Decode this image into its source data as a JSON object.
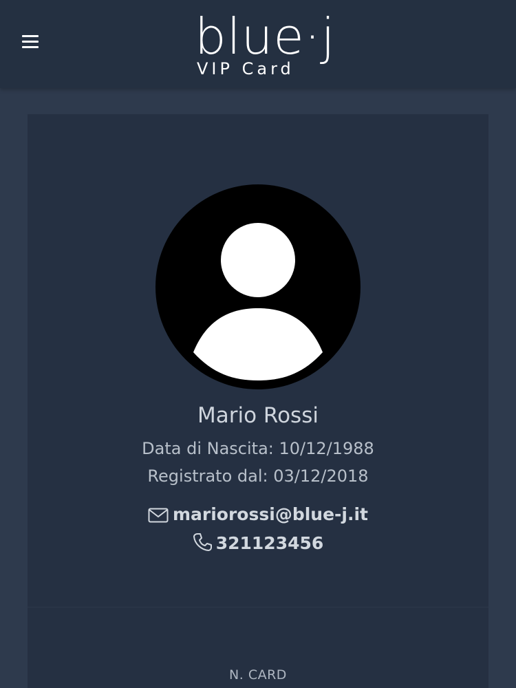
{
  "header": {
    "logo_main": "blue·j",
    "logo_sub": "VIP Card",
    "menu_icon": "hamburger-menu-icon"
  },
  "profile": {
    "avatar_icon": "user-avatar-icon",
    "name": "Mario Rossi",
    "birth_date": "Data di Nascita: 10/12/1988",
    "registered": "Registrato dal: 03/12/2018",
    "email": "mariorossi@blue-j.it",
    "email_icon": "envelope-icon",
    "phone": "321123456",
    "phone_icon": "phone-icon"
  },
  "card": {
    "number_label": "N. CARD"
  },
  "colors": {
    "background": "#2e3a4d",
    "header": "#243041",
    "card": "#253042",
    "avatar": "#000000"
  }
}
